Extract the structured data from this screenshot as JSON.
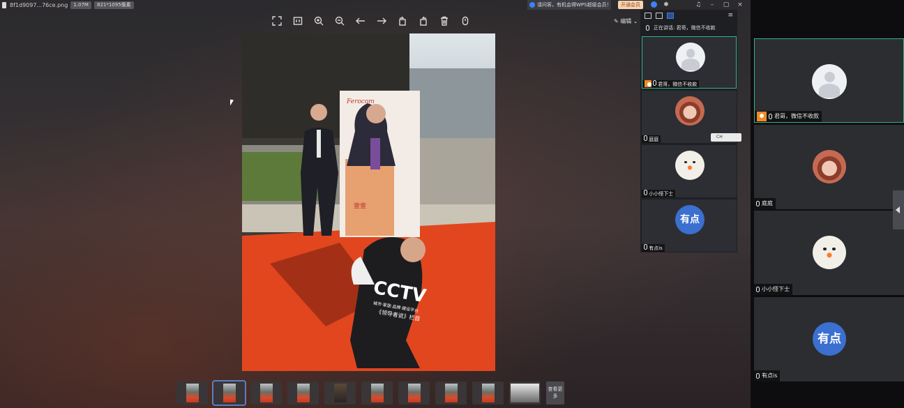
{
  "viewer": {
    "filename": "8f1d9097...76ce.png",
    "filesize": "1.07M",
    "dimensions": "821*1095像素",
    "promo_text": "请问客，有机会得WPS超级会员！",
    "vip_button": "开通会员",
    "edit_label": "编辑",
    "toolbar": [
      "fit-screen-icon",
      "original-size-icon",
      "zoom-in-icon",
      "zoom-out-icon",
      "prev-icon",
      "next-icon",
      "rotate-left-icon",
      "rotate-right-icon",
      "delete-icon",
      "more-icon"
    ],
    "thumbnails_count": 10,
    "more_label": "查看更多",
    "photo_text": {
      "board_brand": "Ferocom",
      "board_name": "壹壹",
      "vest_logo": "CCTV",
      "vest_line1": "城市·家居·品牌·建设平台",
      "vest_line2": "《领导者说》栏目"
    }
  },
  "mini_panel": {
    "speaking_label": "正在讲话: 君哥，微信不收款",
    "tiles": [
      {
        "name": "君哥，微信不收款",
        "avatar": "default",
        "host": true
      },
      {
        "name": "庭庭",
        "avatar": "photo"
      },
      {
        "name": "小小怪下士",
        "avatar": "snowman"
      },
      {
        "name": "有点is",
        "avatar": "text",
        "avatar_text": "有点"
      }
    ],
    "ch_badge": "CH"
  },
  "participants": [
    {
      "name": "君哥，微信不收款",
      "avatar": "default",
      "host": true
    },
    {
      "name": "庭庭",
      "avatar": "photo"
    },
    {
      "name": "小小怪下士",
      "avatar": "snowman"
    },
    {
      "name": "有点is",
      "avatar": "text",
      "avatar_text": "有点"
    }
  ],
  "colors": {
    "accent_green": "#2fb38e",
    "host_orange": "#f08a24",
    "avatar_blue": "#3b6fd0"
  }
}
